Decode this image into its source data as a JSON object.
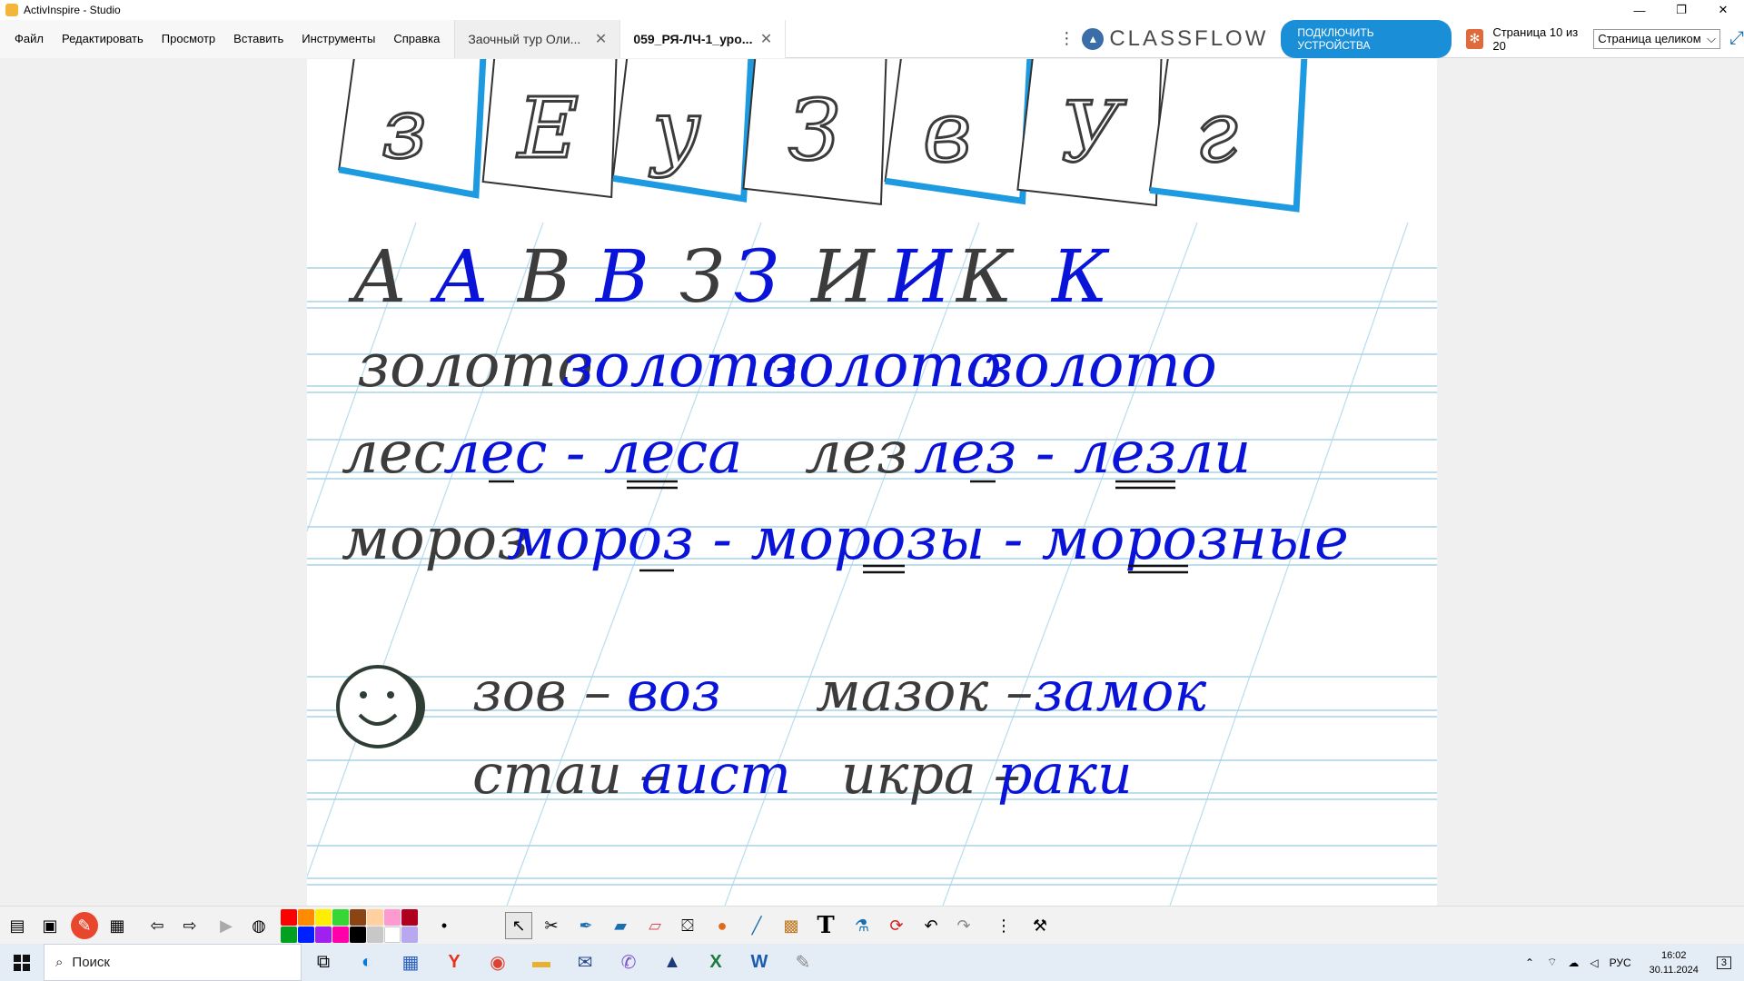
{
  "window": {
    "title": "ActivInspire - Studio",
    "controls": [
      "—",
      "❐",
      "✕"
    ]
  },
  "menu": [
    "Файл",
    "Редактировать",
    "Просмотр",
    "Вставить",
    "Инструменты",
    "Справка"
  ],
  "tabs": [
    {
      "label": "Заочный тур Оли...",
      "close": "✕",
      "active": false
    },
    {
      "label": "059_РЯ-ЛЧ-1_уро...",
      "close": "✕",
      "active": true
    }
  ],
  "header": {
    "kebab": "⋮",
    "classflow": "CLASSFLOW",
    "connect_button": "ПОДКЛЮЧИТЬ УСТРОЙСТВА",
    "page_info": "Страница 10 из 20",
    "zoom": "Страница целиком",
    "zoom_arrow": "⌵"
  },
  "flipchart": {
    "top_letters": [
      "з",
      "Е",
      "у",
      "З",
      "в",
      "У",
      "г"
    ],
    "alphabet_row": [
      {
        "text": "А",
        "color": "gray"
      },
      {
        "text": "А",
        "color": "blue"
      },
      {
        "text": "В",
        "color": "gray"
      },
      {
        "text": "В",
        "color": "blue"
      },
      {
        "text": "З",
        "color": "gray"
      },
      {
        "text": "З",
        "color": "blue"
      },
      {
        "text": "И",
        "color": "gray"
      },
      {
        "text": "И",
        "color": "blue"
      },
      {
        "text": "К",
        "color": "gray"
      },
      {
        "text": "К",
        "color": "blue"
      }
    ],
    "row_zoloto": {
      "gray": "золото",
      "blue": [
        "золото",
        "золото",
        "золото"
      ]
    },
    "row_les": {
      "gray1": "лес",
      "blue1": "лес - леса",
      "gray2": "лез",
      "blue2": "лез - лезли"
    },
    "row_moroz": {
      "gray": "мороз",
      "blue": "мороз - морозы - морозные"
    },
    "pairs": {
      "line1_gray1": "зов –",
      "line1_blue1": "воз",
      "line1_gray2": "мазок –",
      "line1_blue2": "замок",
      "line2_gray1": "стаи –",
      "line2_blue1": "аист",
      "line2_gray2": "икра –",
      "line2_blue2": "раки"
    }
  },
  "taskbar": {
    "search_placeholder": "Поиск",
    "lang": "РУС",
    "time": "16:02",
    "date": "30.11.2024",
    "notifications": "3"
  },
  "colors": {
    "ink_blue": "#0a14d8",
    "ink_gray": "#3c3c3c",
    "ruled_line": "#a9d3e8",
    "card_blue": "#1e9be0",
    "accent_button": "#1a8fd8"
  }
}
